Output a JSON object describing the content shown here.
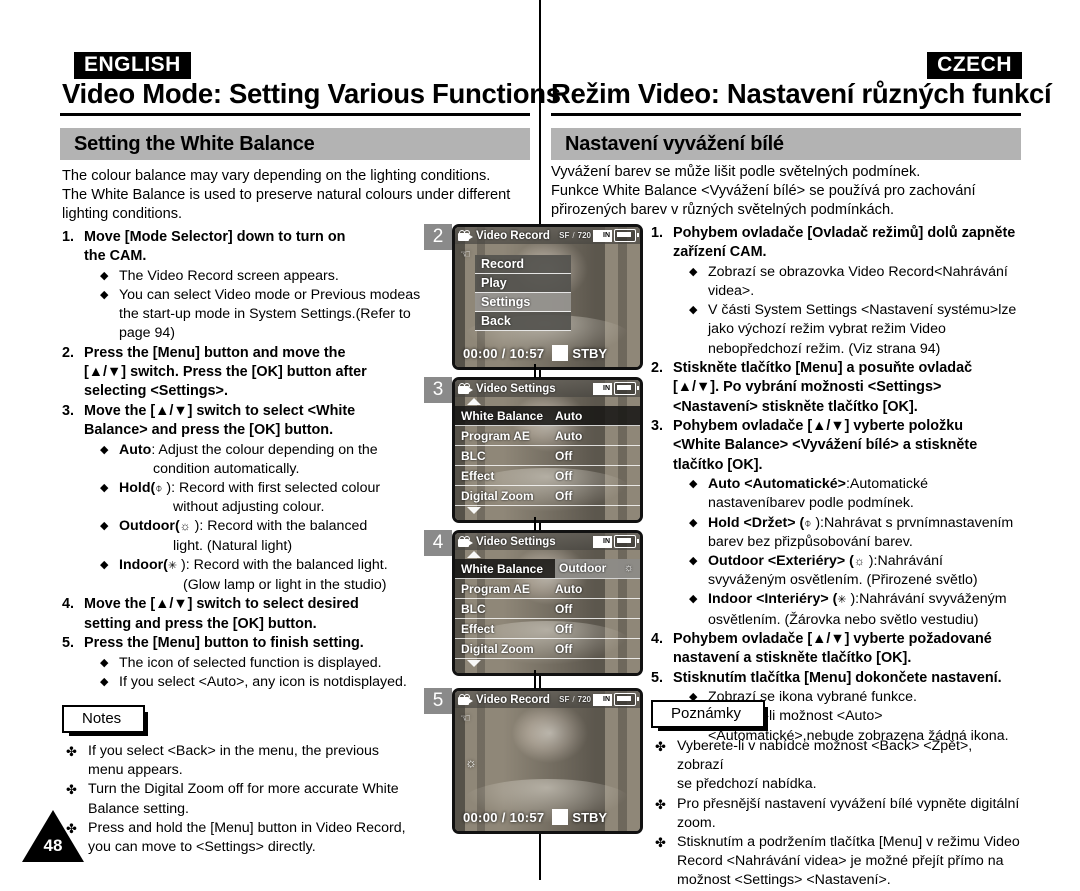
{
  "left": {
    "language_tag": "ENGLISH",
    "main_heading": "Video Mode: Setting Various Functions",
    "section_title": "Setting the White Balance",
    "intro": [
      "The colour balance may vary depending on the lighting conditions.",
      "The White Balance is used to preserve natural colours under different",
      "lighting conditions."
    ],
    "steps": [
      {
        "num": "1.",
        "title_lines": [
          "Move [Mode Selector] down to turn on",
          "the CAM."
        ],
        "bullets": [
          {
            "text": "The Video Record screen appears."
          },
          {
            "text": "You can select Video mode or Previous mode",
            "cont": [
              "as the start-up mode in System Settings.",
              "(Refer to page 94)"
            ]
          }
        ]
      },
      {
        "num": "2.",
        "title_lines": [
          "Press the [Menu] button and move the",
          "[▲/▼] switch. Press the [OK] button after",
          "selecting <Settings>."
        ],
        "bullets": []
      },
      {
        "num": "3.",
        "title_lines": [
          "Move the [▲/▼] switch to select <White",
          "Balance> and press the [OK] button."
        ],
        "bullets": [
          {
            "bold": "Auto",
            "text": ": Adjust the colour depending on the",
            "cont_indent": [
              "condition automatically."
            ]
          },
          {
            "bold": "Hold(",
            "icon": "hold-icon",
            "text": "): Record with first selected colour",
            "cont_indent2": [
              "without adjusting colour."
            ]
          },
          {
            "bold": "Outdoor(",
            "icon": "sun-icon",
            "text": "): Record with the balanced",
            "cont_indent3": [
              "light. (Natural light)"
            ]
          },
          {
            "bold": "Indoor(",
            "icon": "bulb-icon",
            "text": "): Record with the balanced light.",
            "cont_indent4": [
              "(Glow lamp or light in the studio)"
            ]
          }
        ]
      },
      {
        "num": "4.",
        "title_lines": [
          "Move the [▲/▼] switch to select desired",
          "setting and press the [OK] button."
        ],
        "bullets": []
      },
      {
        "num": "5.",
        "title_lines": [
          "Press the [Menu] button to finish setting."
        ],
        "bullets": [
          {
            "text": "The icon of selected function is displayed."
          },
          {
            "text": "If you select <Auto>, any icon is not",
            "cont": [
              "displayed."
            ]
          }
        ]
      }
    ],
    "notes_label": "Notes",
    "notes": [
      [
        "If you select <Back> in the menu, the previous",
        "menu appears."
      ],
      [
        "Turn the Digital Zoom off for more accurate White",
        "Balance setting."
      ],
      [
        "Press and hold the [Menu] button in Video Record,",
        "you can move to <Settings> directly."
      ]
    ],
    "page_number": "48"
  },
  "right": {
    "language_tag": "CZECH",
    "main_heading": "Režim Video: Nastavení různých funkcí",
    "section_title": "Nastavení vyvážení bílé",
    "intro": [
      "Vyvážení barev se může lišit podle světelných podmínek.",
      "Funkce White Balance <Vyvážení bílé> se používá pro zachování",
      "přirozených barev v různých světelných podmínkách."
    ],
    "steps": [
      {
        "num": "1.",
        "title_lines": [
          "Pohybem ovladače [Ovladač režimů] dolů zapněte",
          "zařízení CAM."
        ],
        "bullets": [
          {
            "text": "Zobrazí se obrazovka Video Record",
            "cont": [
              "<Nahrávání videa>."
            ]
          },
          {
            "text": "V části System Settings <Nastavení systému>",
            "cont": [
              "lze jako výchozí režim vybrat režim Video nebo",
              "předchozí režim. (Viz strana 94)"
            ]
          }
        ]
      },
      {
        "num": "2.",
        "title_lines": [
          "Stiskněte tlačítko [Menu] a posuňte ovladač",
          "[▲/▼]. Po vybrání možnosti <Settings>",
          "<Nastavení> stiskněte tlačítko [OK]."
        ],
        "bullets": []
      },
      {
        "num": "3.",
        "title_lines": [
          "Pohybem ovladače [▲/▼] vyberte položku",
          "<White Balance> <Vyvážení bílé> a stiskněte",
          "tlačítko [OK]."
        ],
        "bullets": [
          {
            "bold": "Auto <Automatické>",
            "text": ":Automatické nastavení",
            "cont": [
              "barev podle podmínek."
            ]
          },
          {
            "bold": "Hold <Držet> (",
            "icon": "hold-icon",
            "text": "):Nahrávat s prvním",
            "cont": [
              "nastavením barev bez přizpůsobování barev."
            ]
          },
          {
            "bold": "Outdoor <Exteriéry> (",
            "icon": "sun-icon",
            "text": "):Nahrávání s",
            "cont": [
              "vyváženým osvětlením. (Přirozené světlo)"
            ]
          },
          {
            "bold": "Indoor <Interiéry> (",
            "icon": "bulb-icon",
            "text": "):Nahrávání s",
            "cont": [
              "vyváženým osvětlením. (Žárovka nebo světlo ve",
              "studiu)"
            ]
          }
        ]
      },
      {
        "num": "4.",
        "title_lines": [
          "Pohybem ovladače [▲/▼] vyberte požadované",
          "nastavení a stiskněte tlačítko [OK]."
        ],
        "bullets": []
      },
      {
        "num": "5.",
        "title_lines": [
          "Stisknutím tlačítka [Menu] dokončete nastavení."
        ],
        "bullets": [
          {
            "text": "Zobrazí se ikona vybrané funkce."
          },
          {
            "text": "Vyberete-li možnost <Auto> <Automatické>,",
            "cont": [
              "nebude zobrazena žádná ikona."
            ]
          }
        ]
      }
    ],
    "notes_label": "Poznámky",
    "notes": [
      [
        "Vyberete-li v nabídce možnost <Back> <Zpět>, zobrazí",
        "se předchozí nabídka."
      ],
      [
        "Pro přesnější nastavení vyvážení bílé vypněte digitální",
        "zoom."
      ],
      [
        "Stisknutím a podržením tlačítka [Menu] v režimu Video",
        "Record <Nahrávání videa> je možné přejít přímo na",
        "možnost <Settings> <Nastavení>."
      ]
    ]
  },
  "screens": [
    {
      "step_num": "2",
      "type": "record-menu",
      "title": "Video Record",
      "quality": "SF",
      "separator": "/",
      "resolution": "720",
      "memory": "IN",
      "menu_items": [
        {
          "label": "Record",
          "selected": false
        },
        {
          "label": "Play",
          "selected": false
        },
        {
          "label": "Settings",
          "selected": true
        },
        {
          "label": "Back",
          "selected": false
        }
      ],
      "time_elapsed": "00:00",
      "time_sep": "/",
      "time_remaining": "10:57",
      "status": "STBY"
    },
    {
      "step_num": "3",
      "type": "settings",
      "title": "Video Settings",
      "memory": "IN",
      "rows": [
        {
          "label": "White Balance",
          "value": "Auto",
          "highlight": true,
          "value_box": false,
          "icon": ""
        },
        {
          "label": "Program AE",
          "value": "Auto",
          "highlight": false,
          "icon": ""
        },
        {
          "label": "BLC",
          "value": "Off",
          "highlight": false,
          "icon": ""
        },
        {
          "label": "Effect",
          "value": "Off",
          "highlight": false,
          "icon": ""
        },
        {
          "label": "Digital Zoom",
          "value": "Off",
          "highlight": false,
          "icon": ""
        }
      ]
    },
    {
      "step_num": "4",
      "type": "settings",
      "title": "Video Settings",
      "memory": "IN",
      "rows": [
        {
          "label": "White Balance",
          "value": "Outdoor",
          "highlight": true,
          "value_box": true,
          "icon": "sun-icon"
        },
        {
          "label": "Program AE",
          "value": "Auto",
          "highlight": false,
          "icon": ""
        },
        {
          "label": "BLC",
          "value": "Off",
          "highlight": false,
          "icon": ""
        },
        {
          "label": "Effect",
          "value": "Off",
          "highlight": false,
          "icon": ""
        },
        {
          "label": "Digital Zoom",
          "value": "Off",
          "highlight": false,
          "icon": ""
        }
      ]
    },
    {
      "step_num": "5",
      "type": "record",
      "title": "Video Record",
      "quality": "SF",
      "separator": "/",
      "resolution": "720",
      "memory": "IN",
      "overlay_icon": "sun-icon",
      "time_elapsed": "00:00",
      "time_sep": "/",
      "time_remaining": "10:57",
      "status": "STBY"
    }
  ],
  "symbols": {
    "diamond": "◆",
    "clover": "✤",
    "sun": "☀",
    "bulb": "✳"
  }
}
